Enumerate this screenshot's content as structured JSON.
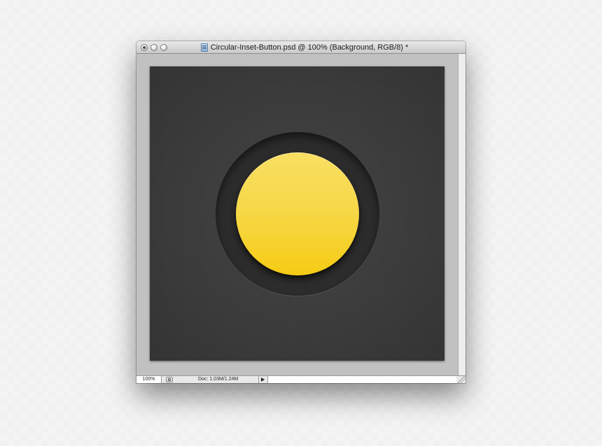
{
  "window": {
    "title": "Circular-Inset-Button.psd @ 100% (Background, RGB/8) *",
    "icons": {
      "close": "close-icon",
      "minimize": "minimize-icon",
      "zoom": "zoom-icon",
      "document": "psd-document-icon"
    }
  },
  "canvas": {
    "background_color": "#3b3b3b",
    "inset_ring_color": "#2c2c2c",
    "button_color_top": "#f9df63",
    "button_color_bottom": "#f5cc14"
  },
  "statusbar": {
    "zoom_value": "100%",
    "doc_info": "Doc: 1.03M/1.24M",
    "icons": {
      "navigator": "navigator-icon",
      "menu_arrow": "triangle-right-icon",
      "resize": "resize-grip-icon"
    }
  }
}
